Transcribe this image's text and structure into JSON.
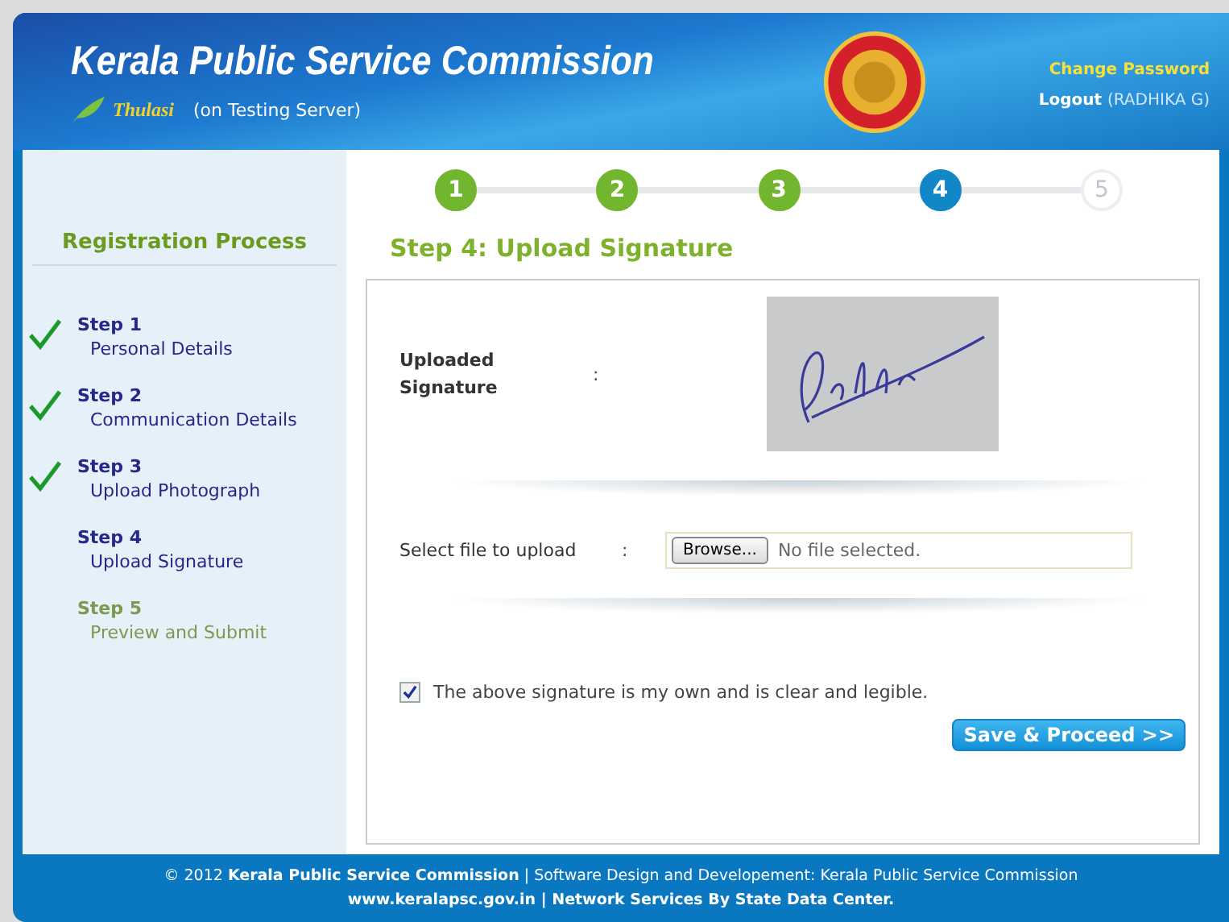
{
  "header": {
    "title": "Kerala Public Service Commission",
    "brand": "Thulasi",
    "server_note": "(on Testing Server)",
    "change_password": "Change Password",
    "logout": "Logout",
    "user": "(RADHIKA G)"
  },
  "sidebar": {
    "title": "Registration Process",
    "steps": [
      {
        "label": "Step 1",
        "name": "Personal Details",
        "completed": true,
        "disabled": false
      },
      {
        "label": "Step 2",
        "name": "Communication Details",
        "completed": true,
        "disabled": false
      },
      {
        "label": "Step 3",
        "name": "Upload Photograph",
        "completed": true,
        "disabled": false
      },
      {
        "label": "Step 4",
        "name": "Upload Signature",
        "disabled": false
      },
      {
        "label": "Step 5",
        "name": "Preview and Submit",
        "disabled": true
      }
    ]
  },
  "progress": [
    {
      "label": "1",
      "completed": true,
      "selected": false
    },
    {
      "label": "2",
      "completed": true,
      "selected": false
    },
    {
      "label": "3",
      "completed": true,
      "selected": false
    },
    {
      "label": "4",
      "completed": false,
      "selected": true
    },
    {
      "label": "5",
      "completed": false,
      "selected": false
    }
  ],
  "main": {
    "heading": "Step 4: Upload Signature",
    "signature": {
      "label": "Uploaded Signature",
      "separator": ":"
    },
    "file": {
      "label": "Select file to upload",
      "separator": ":",
      "button": "Browse...",
      "value": "No file selected."
    },
    "declaration": {
      "text": "The above signature is my own and is clear and legible.",
      "checked": true
    },
    "submit": "Save & Proceed >>"
  },
  "footer": {
    "line_1": "© 2012 **Kerala Public Service Commission** | Software Design and Developement: Kerala Public Service Commission",
    "line_2": "www.keralapsc.gov.in | Network Services By State Data Center."
  }
}
